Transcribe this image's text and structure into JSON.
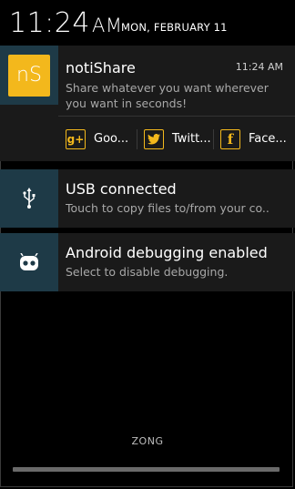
{
  "status": {
    "time": "11:24",
    "ampm": "AM",
    "date": "MON, FEBRUARY 11"
  },
  "notifications": [
    {
      "app": "notiShare",
      "icon": "nS",
      "time": "11:24 AM",
      "text": "Share whatever you want wherever you want in seconds!",
      "actions": [
        {
          "label": "Goo...",
          "icon": "google-plus-icon"
        },
        {
          "label": "Twitt...",
          "icon": "twitter-icon"
        },
        {
          "label": "Face...",
          "icon": "facebook-icon"
        }
      ]
    },
    {
      "title": "USB connected",
      "text": "Touch to copy files to/from your co..",
      "icon": "usb-icon"
    },
    {
      "title": "Android debugging enabled",
      "text": "Select to disable debugging.",
      "icon": "android-debug-icon"
    }
  ],
  "carrier": "ZONG",
  "colors": {
    "accent": "#f3b81c",
    "icon_bg": "#1e3a47",
    "card_bg": "#1a1a1a"
  }
}
